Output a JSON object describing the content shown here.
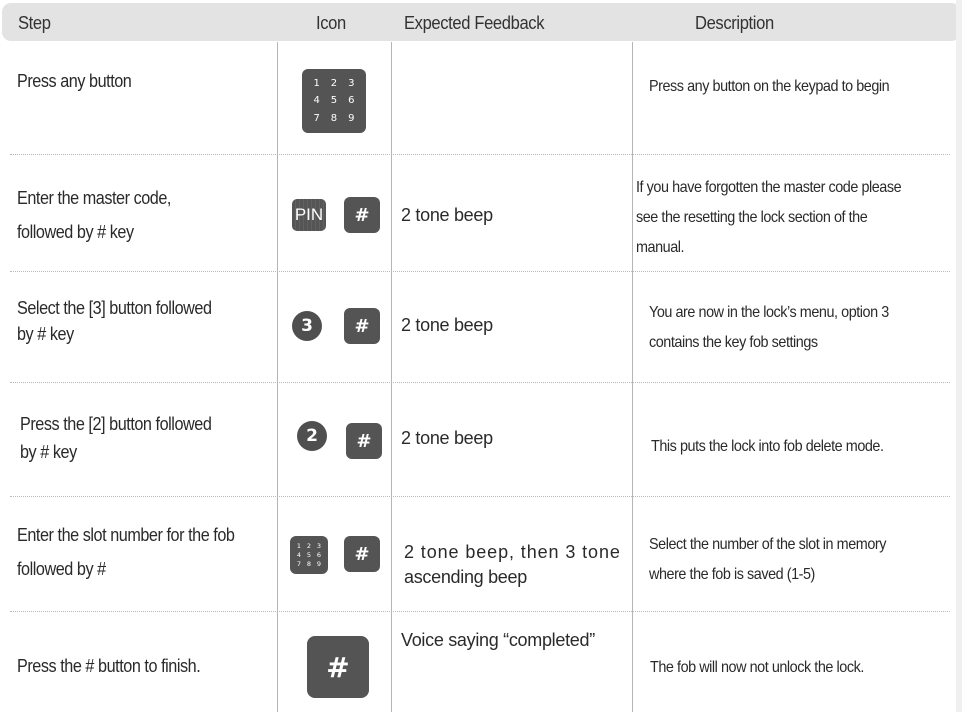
{
  "header": {
    "step": "Step",
    "icon": "Icon",
    "feedback": "Expected Feedback",
    "description": "Description"
  },
  "keypad_digits": [
    "1",
    "2",
    "3",
    "4",
    "5",
    "6",
    "7",
    "8",
    "9"
  ],
  "icons": {
    "pin_label": "PIN",
    "hash_label": "#",
    "digit_3": "3",
    "digit_2": "2"
  },
  "rows": [
    {
      "step_lines": [
        "Press any button"
      ],
      "feedback_lines": [],
      "description_lines": [
        "Press any button on the keypad to begin"
      ],
      "icons": [
        "keypad-icon"
      ]
    },
    {
      "step_lines": [
        "Enter the master code,",
        "followed by # key"
      ],
      "feedback_lines": [
        "2 tone beep"
      ],
      "description_lines": [
        "If you have forgotten the master code please",
        "see the resetting the lock section of the",
        "manual."
      ],
      "icons": [
        "pin-icon",
        "hash-key-icon"
      ]
    },
    {
      "step_lines": [
        "Select the [3] button followed",
        "by # key"
      ],
      "feedback_lines": [
        "2 tone beep"
      ],
      "description_lines": [
        "You are now in the lock’s menu, option 3",
        "contains the key fob settings"
      ],
      "icons": [
        "number-3-icon",
        "hash-key-icon"
      ]
    },
    {
      "step_lines": [
        "Press the [2] button followed",
        "by # key"
      ],
      "feedback_lines": [
        "2 tone beep"
      ],
      "description_lines": [
        "This puts the lock into fob delete mode."
      ],
      "icons": [
        "number-2-icon",
        "hash-key-icon"
      ]
    },
    {
      "step_lines": [
        "Enter the slot number for the fob",
        "followed by #"
      ],
      "feedback_lines": [
        "2 tone beep, then 3 tone",
        "ascending beep"
      ],
      "description_lines": [
        "Select the number of the slot in memory",
        "where the fob is saved (1-5)"
      ],
      "icons": [
        "keypad-icon",
        "hash-key-icon"
      ]
    },
    {
      "step_lines": [
        "Press the # button to finish."
      ],
      "feedback_lines": [
        "Voice saying “completed”"
      ],
      "description_lines": [
        "The fob will now not unlock the lock."
      ],
      "icons": [
        "hash-key-icon"
      ]
    }
  ],
  "colors": {
    "header_bg": "#e3e3e4",
    "icon_fill": "#545454",
    "text": "#2a2a2a",
    "divider": "#b5b5b5"
  }
}
